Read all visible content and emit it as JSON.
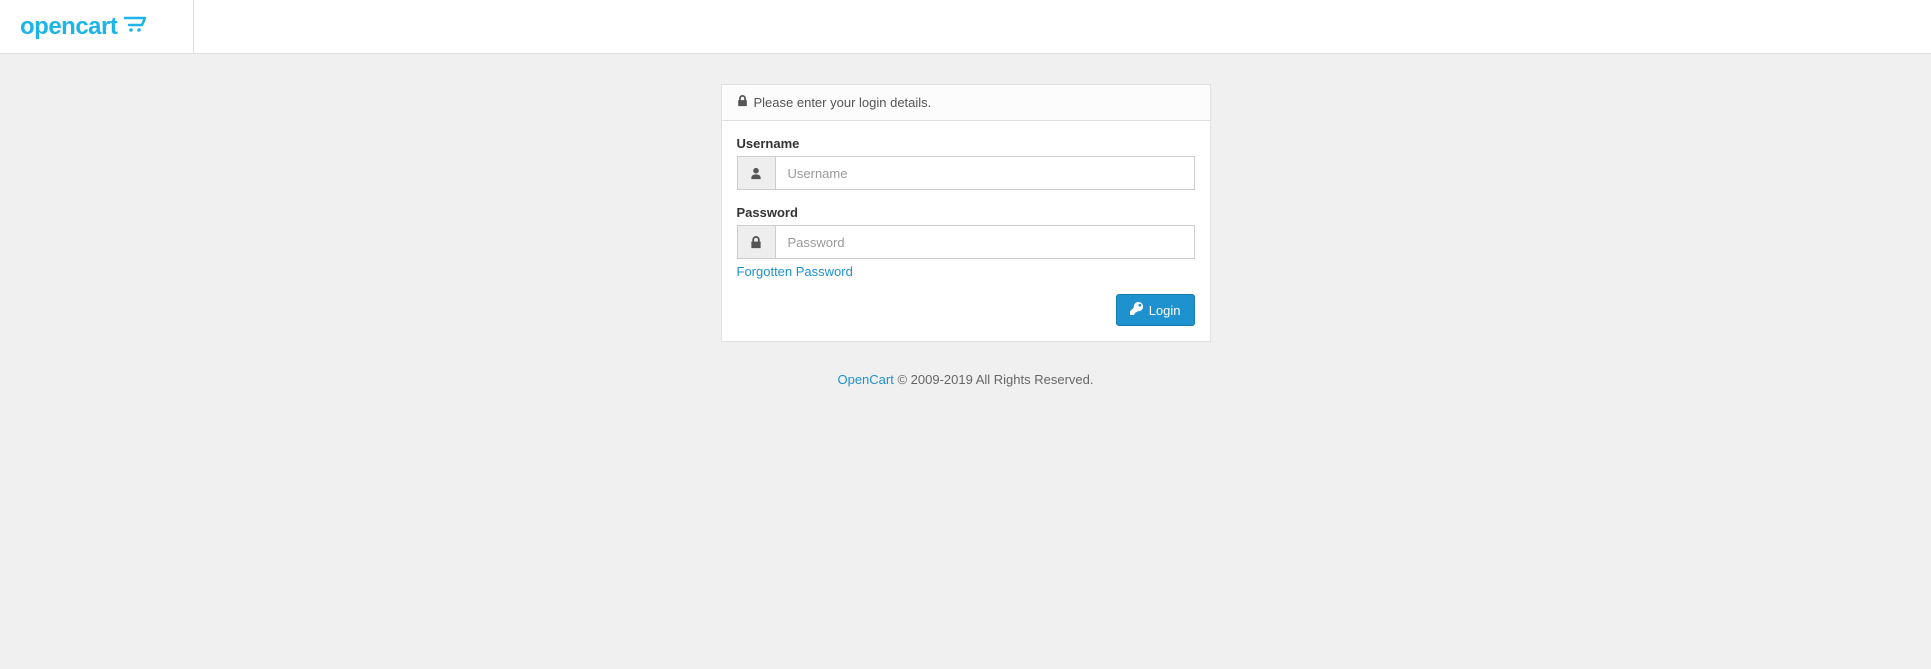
{
  "header": {
    "logo_text": "opencart"
  },
  "panel": {
    "title": "Please enter your login details."
  },
  "form": {
    "username": {
      "label": "Username",
      "placeholder": "Username",
      "value": ""
    },
    "password": {
      "label": "Password",
      "placeholder": "Password",
      "value": ""
    },
    "forgotten_link": "Forgotten Password",
    "login_button": "Login"
  },
  "footer": {
    "link_text": "OpenCart",
    "rights_text": " © 2009-2019 All Rights Reserved."
  }
}
